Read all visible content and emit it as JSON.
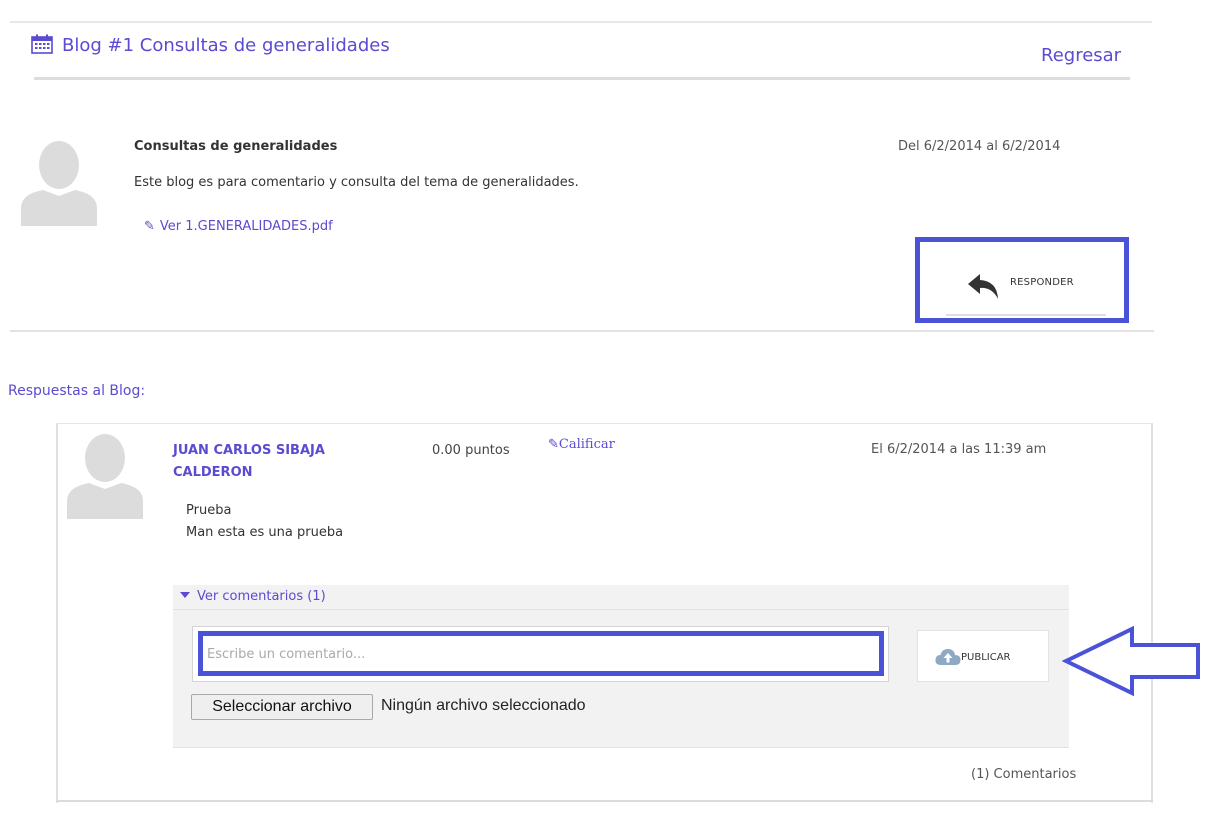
{
  "header": {
    "title": "Blog #1 Consultas de generalidades",
    "icon": "calendar-icon",
    "back_label": "Regresar"
  },
  "post": {
    "title": "Consultas de generalidades",
    "date_range": "Del 6/2/2014 al 6/2/2014",
    "body": "Este blog es para comentario y consulta del tema de generalidades.",
    "attachment_label": "Ver 1.GENERALIDADES.pdf",
    "reply_label": "RESPONDER"
  },
  "replies": {
    "heading": "Respuestas al Blog:",
    "items": [
      {
        "author": "JUAN CARLOS SIBAJA CALDERON",
        "points": "0.00 puntos",
        "rate_label": "Calificar",
        "date": "El 6/2/2014 a las 11:39 am",
        "title": "Prueba",
        "body": "Man esta es una prueba",
        "comments_toggle": "Ver comentarios (1)",
        "comment_placeholder": "Escribe un comentario...",
        "publish_label": "PUBLICAR",
        "file_button": "Seleccionar archivo",
        "file_status": "Ningún archivo seleccionado",
        "comments_count": "(1) Comentarios"
      }
    ]
  },
  "colors": {
    "accent": "#5a4bd1",
    "annotation": "#4a52d8",
    "panel": "#f2f2f2"
  }
}
